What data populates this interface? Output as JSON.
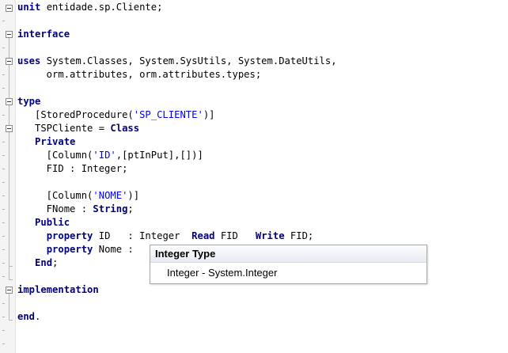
{
  "editor": {
    "lines": [
      [
        {
          "t": "unit",
          "c": "kw"
        },
        {
          "t": " entidade.sp.Cliente;"
        }
      ],
      [],
      [
        {
          "t": "interface",
          "c": "kw"
        }
      ],
      [],
      [
        {
          "t": "uses",
          "c": "kw"
        },
        {
          "t": " System.Classes, System.SysUtils, System.DateUtils,"
        }
      ],
      [
        {
          "t": "     orm.attributes, orm.attributes.types;"
        }
      ],
      [],
      [
        {
          "t": "type",
          "c": "kw"
        }
      ],
      [
        {
          "t": "   [StoredProcedure("
        },
        {
          "t": "'SP_CLIENTE'",
          "c": "str"
        },
        {
          "t": ")]"
        }
      ],
      [
        {
          "t": "   TSPCliente = "
        },
        {
          "t": "Class",
          "c": "kw"
        }
      ],
      [
        {
          "t": "   "
        },
        {
          "t": "Private",
          "c": "kw"
        }
      ],
      [
        {
          "t": "     [Column("
        },
        {
          "t": "'ID'",
          "c": "str"
        },
        {
          "t": ",[ptInPut],[])]"
        }
      ],
      [
        {
          "t": "     FID : Integer;"
        }
      ],
      [],
      [
        {
          "t": "     [Column("
        },
        {
          "t": "'NOME'",
          "c": "str"
        },
        {
          "t": ")]"
        }
      ],
      [
        {
          "t": "     FNome : "
        },
        {
          "t": "String",
          "c": "kw"
        },
        {
          "t": ";"
        }
      ],
      [
        {
          "t": "   "
        },
        {
          "t": "Public",
          "c": "kw"
        }
      ],
      [
        {
          "t": "     "
        },
        {
          "t": "property",
          "c": "kw"
        },
        {
          "t": " ID   : Integer  "
        },
        {
          "t": "Read",
          "c": "kw"
        },
        {
          "t": " FID   "
        },
        {
          "t": "Write",
          "c": "kw"
        },
        {
          "t": " FID;"
        }
      ],
      [
        {
          "t": "     "
        },
        {
          "t": "property",
          "c": "kw"
        },
        {
          "t": " Nome : "
        }
      ],
      [
        {
          "t": "   "
        },
        {
          "t": "End",
          "c": "kw"
        },
        {
          "t": ";"
        }
      ],
      [],
      [
        {
          "t": "implementation",
          "c": "kw"
        }
      ],
      [],
      [
        {
          "t": "end",
          "c": "kw"
        },
        {
          "t": "."
        }
      ]
    ]
  },
  "tooltip": {
    "header": "Integer Type",
    "item": "Integer - System.Integer"
  },
  "colors": {
    "keyword": "#000080",
    "string": "#0000ff",
    "gutter": "#f4f4f4"
  }
}
